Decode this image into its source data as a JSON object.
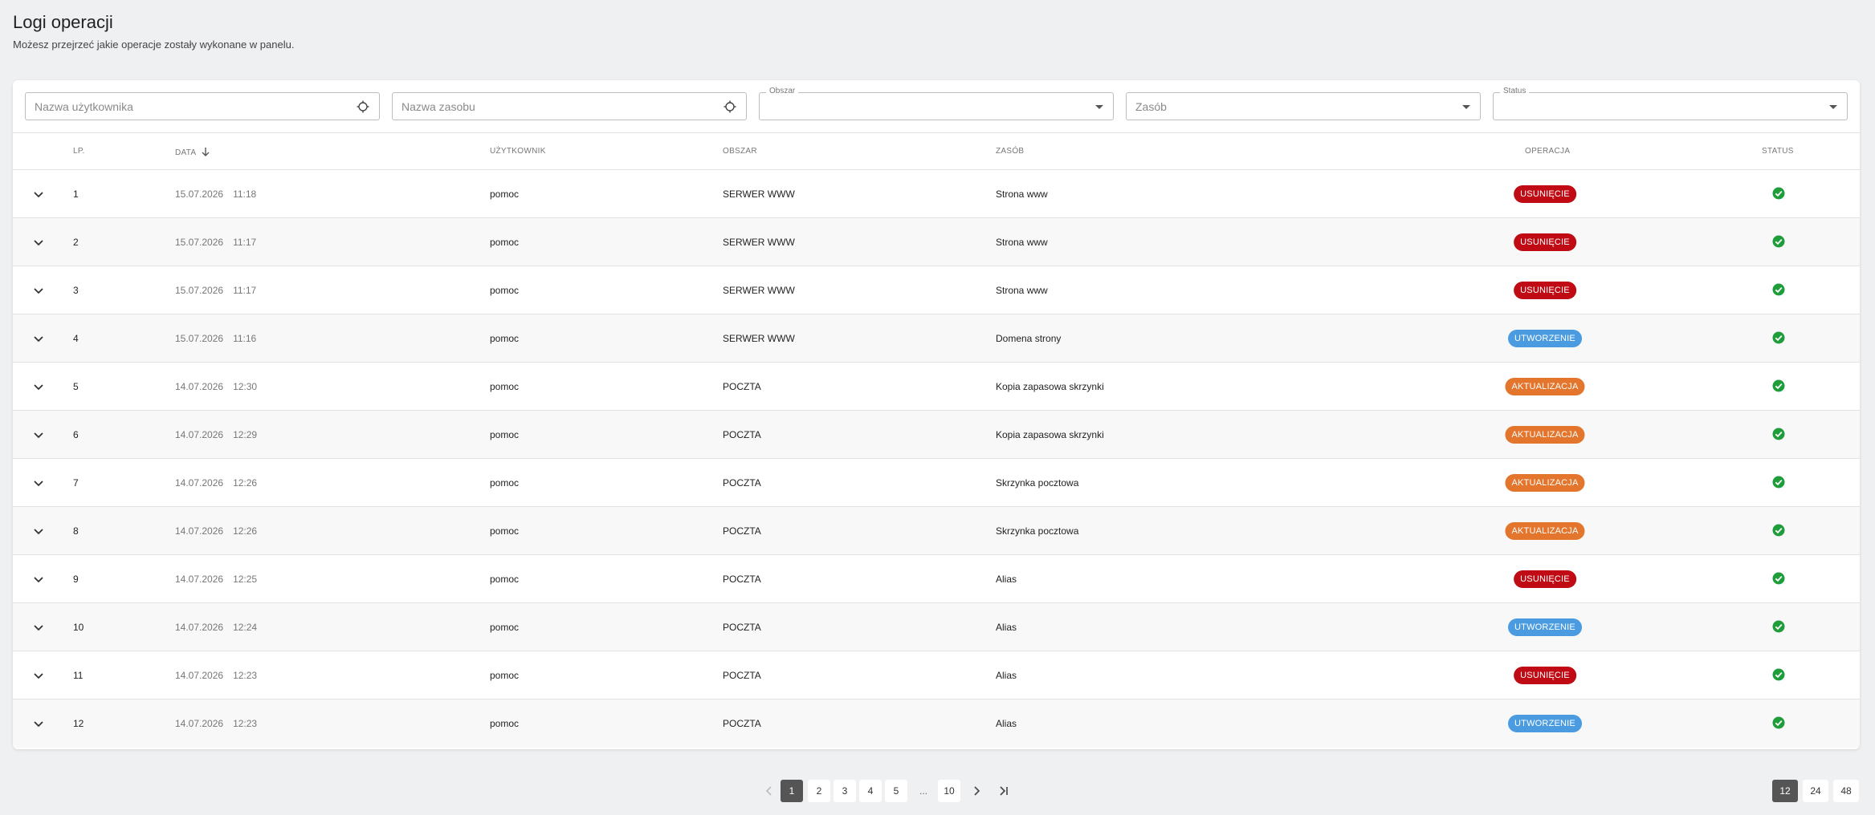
{
  "header": {
    "title": "Logi operacji",
    "subtitle": "Możesz przejrzeć jakie operacje zostały wykonane w panelu."
  },
  "filters": {
    "username_placeholder": "Nazwa użytkownika",
    "resource_name_placeholder": "Nazwa zasobu",
    "area_label": "Obszar",
    "resource_placeholder": "Zasób",
    "status_label": "Status"
  },
  "table": {
    "columns": {
      "lp": "LP.",
      "date": "DATA",
      "user": "UŻYTKOWNIK",
      "area": "OBSZAR",
      "resource": "ZASÓB",
      "operation": "OPERACJA",
      "status": "STATUS"
    },
    "rows": [
      {
        "lp": "1",
        "date": "15.07.2026",
        "time": "11:18",
        "user": "pomoc",
        "area": "SERWER WWW",
        "resource": "Strona www",
        "operation": "USUNIĘCIE",
        "op_type": "del"
      },
      {
        "lp": "2",
        "date": "15.07.2026",
        "time": "11:17",
        "user": "pomoc",
        "area": "SERWER WWW",
        "resource": "Strona www",
        "operation": "USUNIĘCIE",
        "op_type": "del"
      },
      {
        "lp": "3",
        "date": "15.07.2026",
        "time": "11:17",
        "user": "pomoc",
        "area": "SERWER WWW",
        "resource": "Strona www",
        "operation": "USUNIĘCIE",
        "op_type": "del"
      },
      {
        "lp": "4",
        "date": "15.07.2026",
        "time": "11:16",
        "user": "pomoc",
        "area": "SERWER WWW",
        "resource": "Domena strony",
        "operation": "UTWORZENIE",
        "op_type": "new"
      },
      {
        "lp": "5",
        "date": "14.07.2026",
        "time": "12:30",
        "user": "pomoc",
        "area": "POCZTA",
        "resource": "Kopia zapasowa skrzynki",
        "operation": "AKTUALIZACJA",
        "op_type": "upd"
      },
      {
        "lp": "6",
        "date": "14.07.2026",
        "time": "12:29",
        "user": "pomoc",
        "area": "POCZTA",
        "resource": "Kopia zapasowa skrzynki",
        "operation": "AKTUALIZACJA",
        "op_type": "upd"
      },
      {
        "lp": "7",
        "date": "14.07.2026",
        "time": "12:26",
        "user": "pomoc",
        "area": "POCZTA",
        "resource": "Skrzynka pocztowa",
        "operation": "AKTUALIZACJA",
        "op_type": "upd"
      },
      {
        "lp": "8",
        "date": "14.07.2026",
        "time": "12:26",
        "user": "pomoc",
        "area": "POCZTA",
        "resource": "Skrzynka pocztowa",
        "operation": "AKTUALIZACJA",
        "op_type": "upd"
      },
      {
        "lp": "9",
        "date": "14.07.2026",
        "time": "12:25",
        "user": "pomoc",
        "area": "POCZTA",
        "resource": "Alias",
        "operation": "USUNIĘCIE",
        "op_type": "del"
      },
      {
        "lp": "10",
        "date": "14.07.2026",
        "time": "12:24",
        "user": "pomoc",
        "area": "POCZTA",
        "resource": "Alias",
        "operation": "UTWORZENIE",
        "op_type": "new"
      },
      {
        "lp": "11",
        "date": "14.07.2026",
        "time": "12:23",
        "user": "pomoc",
        "area": "POCZTA",
        "resource": "Alias",
        "operation": "USUNIĘCIE",
        "op_type": "del"
      },
      {
        "lp": "12",
        "date": "14.07.2026",
        "time": "12:23",
        "user": "pomoc",
        "area": "POCZTA",
        "resource": "Alias",
        "operation": "UTWORZENIE",
        "op_type": "new"
      }
    ]
  },
  "pagination": {
    "pages": [
      "1",
      "2",
      "3",
      "4",
      "5"
    ],
    "ellipsis": "...",
    "last_page": "10",
    "current": "1",
    "page_sizes": [
      "12",
      "24",
      "48"
    ],
    "current_page_size": "12"
  },
  "colors": {
    "delete": "#c00a14",
    "create": "#4a9be0",
    "update": "#e3762c",
    "status_ok": "#1f9d3a"
  },
  "icons": {
    "filter_adornment": "target-icon",
    "expand": "chevron-down-icon",
    "status": "check-circle-icon",
    "sort": "arrow-down-icon"
  }
}
